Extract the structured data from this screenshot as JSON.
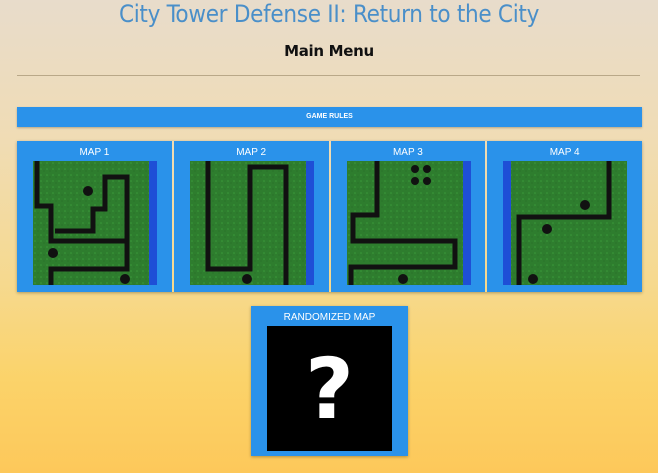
{
  "header": {
    "title": "City Tower Defense II: Return to the City",
    "subtitle": "Main Menu"
  },
  "buttons": {
    "game_rules": "GAME RULES"
  },
  "maps": [
    {
      "label": "MAP 1"
    },
    {
      "label": "MAP 2"
    },
    {
      "label": "MAP 3"
    },
    {
      "label": "MAP 4"
    }
  ],
  "random_map": {
    "label": "RANDOMIZED MAP",
    "icon": "?"
  },
  "colors": {
    "accent": "#2a92ea",
    "title": "#4a8fc9",
    "grass": "#2c7a2c",
    "road": "#111111",
    "river": "#1e4fd6"
  }
}
